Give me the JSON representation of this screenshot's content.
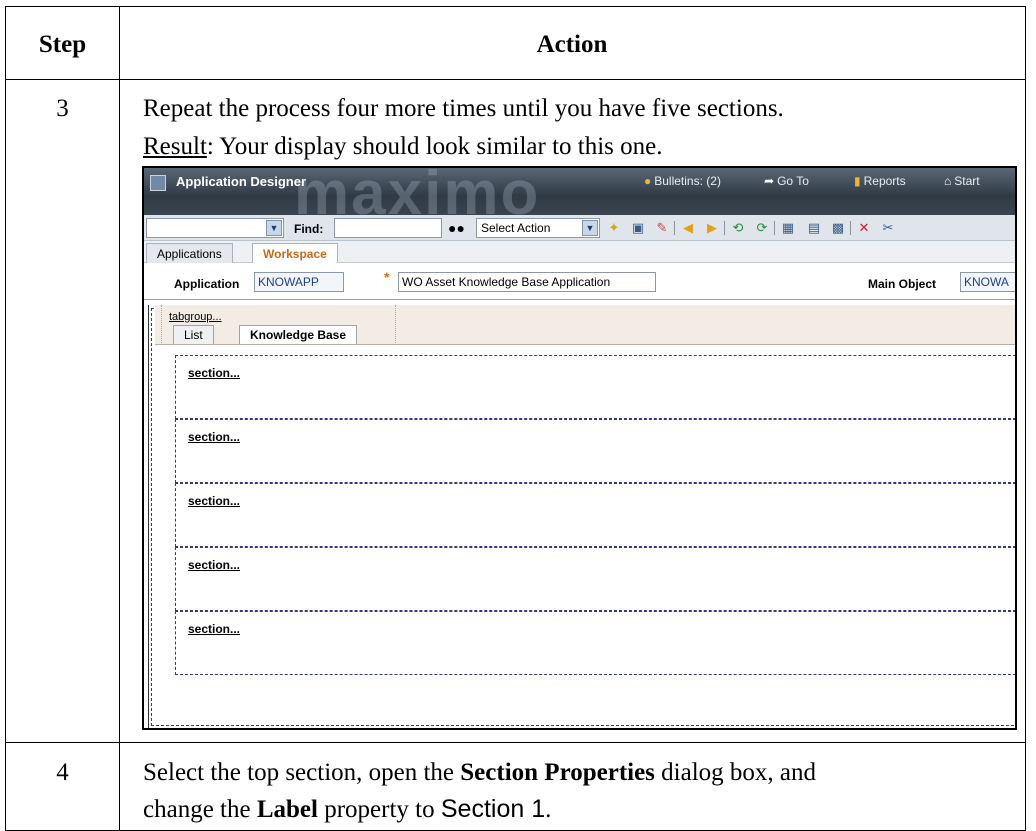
{
  "table": {
    "header": {
      "step": "Step",
      "action": "Action"
    },
    "rows": [
      {
        "step": "3",
        "line1": "Repeat the process four more times until you have five sections.",
        "result_label": "Result",
        "result_text": ": Your display should look similar to this one."
      },
      {
        "step": "4",
        "t1": "Select the top section, open the ",
        "b1": "Section Properties",
        "t2": " dialog box, and",
        "t3": "change the ",
        "b2": "Label",
        "t4": " property to ",
        "s1": "Section 1",
        "t5": "."
      }
    ]
  },
  "screenshot": {
    "title": "Application Designer",
    "watermark": "maximo",
    "nav": {
      "bulletins": "Bulletins: (2)",
      "goto": "Go To",
      "reports": "Reports",
      "start": "Start"
    },
    "toolbar": {
      "find_label": "Find:",
      "find_value": "",
      "select_action": "Select Action"
    },
    "tabs": [
      "Applications",
      "Workspace"
    ],
    "application_label": "Application",
    "application_value": "KNOWAPP",
    "description_value": "WO Asset Knowledge Base Application",
    "main_object_label": "Main Object",
    "main_object_value": "KNOWA",
    "tabgroup_label": "tabgroup...",
    "inner_tabs": [
      "List",
      "Knowledge Base"
    ],
    "sections": [
      "section...",
      "section...",
      "section...",
      "section...",
      "section..."
    ]
  }
}
